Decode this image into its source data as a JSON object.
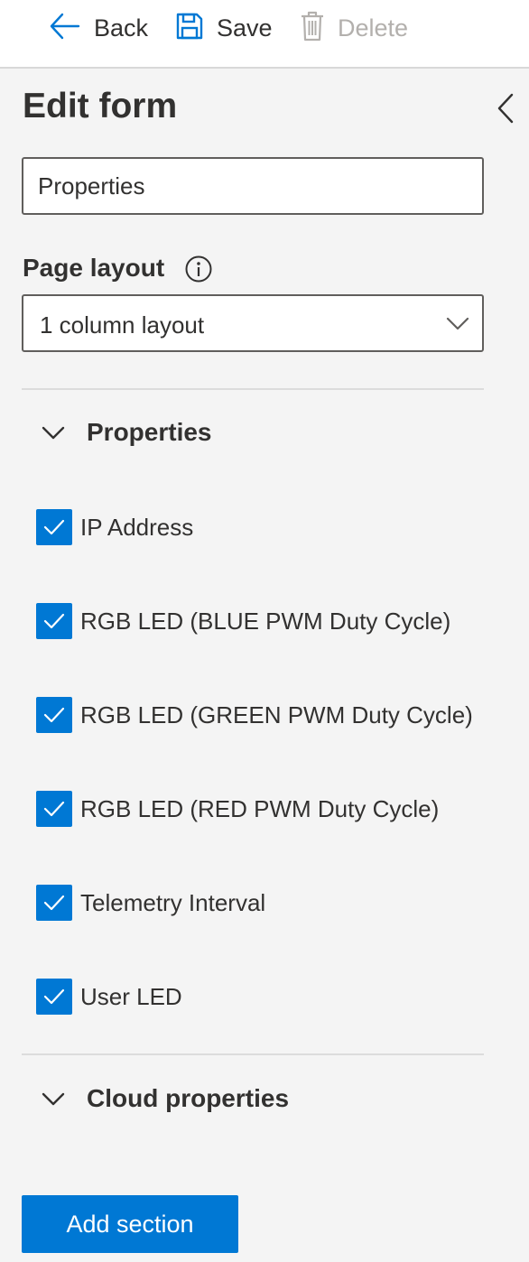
{
  "toolbar": {
    "back_label": "Back",
    "save_label": "Save",
    "delete_label": "Delete"
  },
  "panel": {
    "title": "Edit form",
    "name_input_value": "Properties",
    "page_layout": {
      "label": "Page layout",
      "selected": "1 column layout"
    },
    "sections": [
      {
        "title": "Properties",
        "expanded": true,
        "items": [
          {
            "label": "IP Address",
            "checked": true
          },
          {
            "label": "RGB LED (BLUE PWM Duty Cycle)",
            "checked": true
          },
          {
            "label": "RGB LED (GREEN PWM Duty Cycle)",
            "checked": true
          },
          {
            "label": "RGB LED (RED PWM Duty Cycle)",
            "checked": true
          },
          {
            "label": "Telemetry Interval",
            "checked": true
          },
          {
            "label": "User LED",
            "checked": true
          }
        ]
      },
      {
        "title": "Cloud properties",
        "expanded": true
      }
    ],
    "add_section_label": "Add section"
  },
  "colors": {
    "accent": "#0078d4",
    "text": "#323130",
    "disabled_text": "#b3b0ad",
    "panel_bg": "#f4f4f4"
  },
  "icons": {
    "back": "arrow-left-icon",
    "save": "floppy-disk-icon",
    "delete": "trash-icon",
    "collapse": "chevron-left-icon",
    "info": "info-icon",
    "dropdown": "chevron-down-icon",
    "section": "chevron-down-icon",
    "check": "checkmark-icon"
  }
}
